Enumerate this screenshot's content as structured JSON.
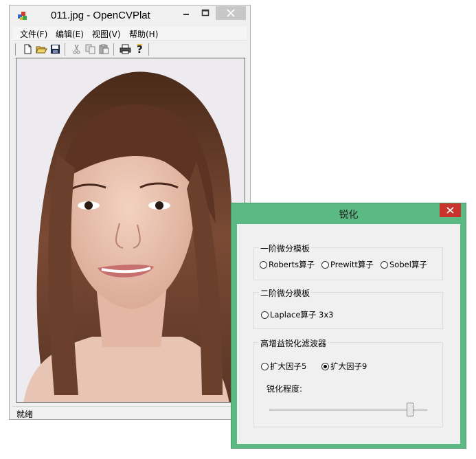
{
  "main_window": {
    "title": "011.jpg - OpenCVPlat",
    "menu": [
      "文件(F)",
      "编辑(E)",
      "视图(V)",
      "帮助(H)"
    ],
    "toolbar_icons": [
      "new-file-icon",
      "open-folder-icon",
      "save-icon",
      "cut-icon",
      "copy-icon",
      "paste-icon",
      "print-icon",
      "help-icon"
    ],
    "status": "就绪"
  },
  "dialog": {
    "title": "锐化",
    "groups": {
      "first_order": {
        "label": "一阶微分模板",
        "options": [
          "Roberts算子",
          "Prewitt算子",
          "Sobel算子"
        ]
      },
      "second_order": {
        "label": "二阶微分模板",
        "options": [
          "Laplace算子 3x3"
        ]
      },
      "high_boost": {
        "label": "高增益锐化滤波器",
        "options": [
          "扩大因子5",
          "扩大因子9"
        ],
        "selected": "扩大因子9",
        "slider_label": "锐化程度:",
        "slider_fraction": 0.89
      }
    }
  },
  "colors": {
    "dialog_frame": "#5bb984",
    "close_red": "#c8342b"
  }
}
